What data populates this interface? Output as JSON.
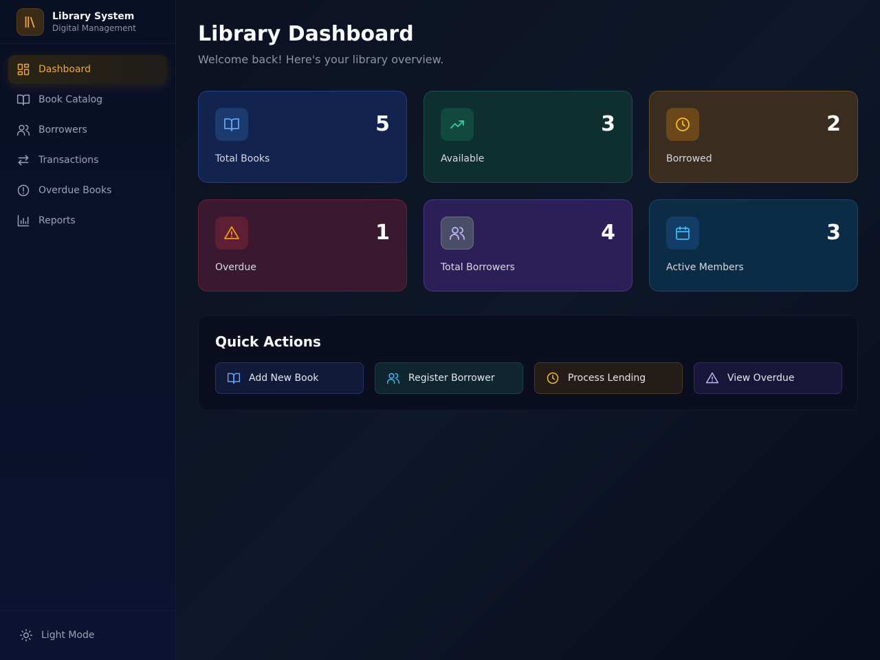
{
  "brand": {
    "title": "Library System",
    "subtitle": "Digital Management",
    "logo_icon": "library-books-icon",
    "accent_color": "#f0a93a"
  },
  "sidebar": {
    "items": [
      {
        "label": "Dashboard",
        "icon": "layout-grid-icon",
        "active": true
      },
      {
        "label": "Book Catalog",
        "icon": "open-book-icon",
        "active": false
      },
      {
        "label": "Borrowers",
        "icon": "users-icon",
        "active": false
      },
      {
        "label": "Transactions",
        "icon": "arrows-swap-icon",
        "active": false
      },
      {
        "label": "Overdue Books",
        "icon": "alert-circle-icon",
        "active": false
      },
      {
        "label": "Reports",
        "icon": "bar-chart-icon",
        "active": false
      }
    ],
    "footer": {
      "label": "Light Mode",
      "icon": "sun-icon"
    }
  },
  "header": {
    "title": "Library Dashboard",
    "subtitle": "Welcome back! Here's your library overview."
  },
  "stats": [
    {
      "label": "Total Books",
      "value": "5",
      "icon": "open-book-icon",
      "color": "#60a5fa"
    },
    {
      "label": "Available",
      "value": "3",
      "icon": "trending-up-icon",
      "color": "#34d399"
    },
    {
      "label": "Borrowed",
      "value": "2",
      "icon": "clock-icon",
      "color": "#fbbf24"
    },
    {
      "label": "Overdue",
      "value": "1",
      "icon": "warning-triangle-icon",
      "color": "#f59e0b"
    },
    {
      "label": "Total Borrowers",
      "value": "4",
      "icon": "users-icon",
      "color": "#c4b5fd"
    },
    {
      "label": "Active Members",
      "value": "3",
      "icon": "calendar-icon",
      "color": "#38bdf8"
    }
  ],
  "quick_actions": {
    "title": "Quick Actions",
    "buttons": [
      {
        "label": "Add New Book",
        "icon": "open-book-icon",
        "color": "#60a5fa"
      },
      {
        "label": "Register Borrower",
        "icon": "users-icon",
        "color": "#38bdf8"
      },
      {
        "label": "Process Lending",
        "icon": "clock-icon",
        "color": "#fbbf24"
      },
      {
        "label": "View Overdue",
        "icon": "warning-triangle-icon",
        "color": "#c4b5fd"
      }
    ]
  }
}
